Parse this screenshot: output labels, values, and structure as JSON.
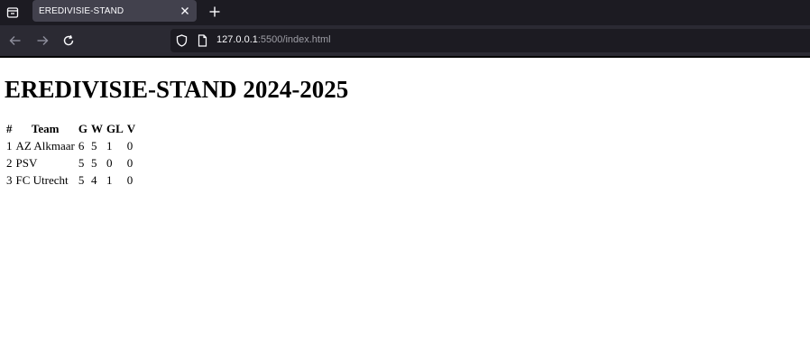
{
  "browser": {
    "tab_title": "EREDIVISIE-STAND",
    "url_host": "127.0.0.1",
    "url_rest": ":5500/index.html",
    "colors": {
      "tabbar_bg": "#1c1b22",
      "active_tab_bg": "#42414d",
      "navbar_bg": "#2b2a33",
      "urlbar_bg": "#1c1b22"
    }
  },
  "page": {
    "title": "EREDIVISIE-STAND 2024-2025",
    "table": {
      "headers": [
        "#",
        "Team",
        "G",
        "W",
        "GL",
        "V"
      ],
      "rows": [
        [
          "1",
          "AZ Alkmaar",
          "6",
          "5",
          "1",
          "0"
        ],
        [
          "2",
          "PSV",
          "5",
          "5",
          "0",
          "0"
        ],
        [
          "3",
          "FC Utrecht",
          "5",
          "4",
          "1",
          "0"
        ]
      ]
    }
  }
}
